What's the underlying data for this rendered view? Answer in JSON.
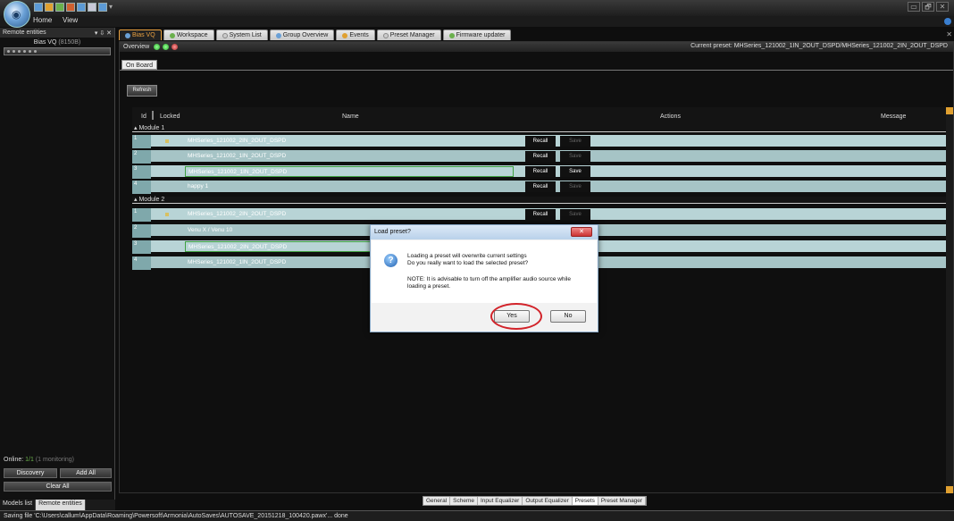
{
  "ribbon": {
    "menu": [
      "Home",
      "View"
    ],
    "window_controls": [
      "▭",
      "🗗",
      "✕"
    ]
  },
  "left_panel": {
    "title": "Remote entities",
    "pin_controls": "▾ ⇩ ✕",
    "entity_name": "Bias VQ",
    "entity_id": "(8150B)",
    "online_label": "Online:",
    "online_count": "1/1",
    "monitoring": "(1 monitoring)",
    "discovery_label": "Discovery",
    "add_all_label": "Add All",
    "clear_all_label": "Clear All",
    "tabs": [
      "Models list",
      "Remote entities"
    ]
  },
  "doc_tabs": [
    "Bias VQ",
    "Workspace",
    "System List",
    "Group Overview",
    "Events",
    "Preset Manager",
    "Firmware updater"
  ],
  "doc_close": "✕",
  "overview": {
    "label": "Overview",
    "current_preset": "Current preset: MHSeries_121002_1IN_2OUT_DSPD/MHSeries_121002_2IN_2OUT_DSPD"
  },
  "onboard_tab": "On Board",
  "refresh_label": "Refresh",
  "grid": {
    "columns": {
      "id": "Id",
      "locked": "Locked",
      "name": "Name",
      "actions": "Actions",
      "message": "Message"
    },
    "recall_label": "Recall",
    "save_label": "Save",
    "modules": [
      {
        "label": "Module 1",
        "rows": [
          {
            "id": "1",
            "name": "MHSeries_121002_2IN_2OUT_DSPD"
          },
          {
            "id": "2",
            "name": "MHSeries_121002_1IN_2OUT_DSPD"
          },
          {
            "id": "3",
            "name": "MHSeries_121002_1IN_2OUT_DSPD"
          },
          {
            "id": "4",
            "name": "happy 1"
          }
        ]
      },
      {
        "label": "Module 2",
        "rows": [
          {
            "id": "1",
            "name": "MHSeries_121002_2IN_2OUT_DSPD"
          },
          {
            "id": "2",
            "name": "Venu X / Venu 10"
          },
          {
            "id": "3",
            "name": "MHSeries_121002_2IN_2OUT_DSPD"
          },
          {
            "id": "4",
            "name": "MHSeries_121002_1IN_2OUT_DSPD"
          }
        ]
      }
    ]
  },
  "bottom_tabs": [
    "General",
    "Scheme",
    "Input Equalizer",
    "Output Equalizer",
    "Presets",
    "Preset Manager"
  ],
  "status": "Saving file 'C:\\Users\\callum\\AppData\\Roaming\\Powersoft\\Armonia\\AutoSaves\\AUTOSAVE_20151218_100420.pawx'... done",
  "dialog": {
    "title": "Load preset?",
    "close": "✕",
    "message_1": "Loading a preset will overwrite current settings",
    "message_2": "Do you really want to load the selected preset?",
    "note": "NOTE: It is advisable to turn off the amplifier audio source while loading a preset.",
    "yes_label": "Yes",
    "no_label": "No"
  }
}
